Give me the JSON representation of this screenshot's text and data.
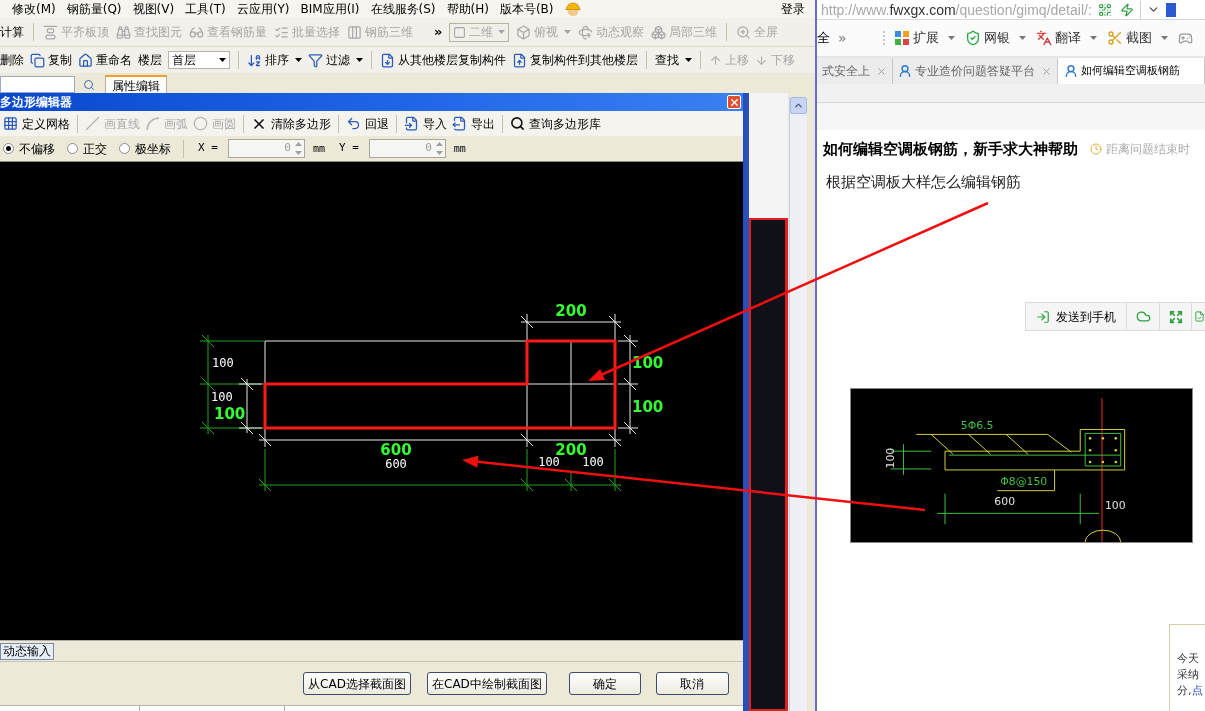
{
  "app": {
    "menu": [
      "修改(M)",
      "钢筋量(Q)",
      "视图(V)",
      "工具(T)",
      "云应用(Y)",
      "BIM应用(I)",
      "在线服务(S)",
      "帮助(H)",
      "版本号(B)"
    ],
    "login": "登录",
    "toolbar_1": [
      {
        "label": "计算",
        "disabled": false
      },
      {
        "label": "平齐板顶",
        "disabled": true
      },
      {
        "label": "查找图元",
        "disabled": true
      },
      {
        "label": "查看钢筋量",
        "disabled": true
      },
      {
        "label": "批量选择",
        "disabled": true
      },
      {
        "label": "钢筋三维",
        "disabled": true
      }
    ],
    "toolbar_1_overflow": "»",
    "view_select": {
      "value": "二维",
      "disabled": true
    },
    "toolbar_1_views": [
      {
        "label": "俯视",
        "disabled": true,
        "dropdown": true
      },
      {
        "label": "动态观察",
        "disabled": true,
        "dropdown": false
      },
      {
        "label": "局部三维",
        "disabled": true,
        "dropdown": false
      },
      {
        "label": "全屏",
        "disabled": true,
        "dropdown": false
      }
    ],
    "toolbar_2": [
      {
        "kind": "button",
        "label": "删除",
        "disabled": false
      },
      {
        "kind": "button",
        "label": "复制",
        "disabled": false
      },
      {
        "kind": "button",
        "label": "重命名",
        "disabled": false
      },
      {
        "kind": "label",
        "label": "楼层",
        "disabled": false
      },
      {
        "kind": "select",
        "label": "首层",
        "disabled": false
      },
      {
        "kind": "menu",
        "label": "排序",
        "disabled": false
      },
      {
        "kind": "menu",
        "label": "过滤",
        "disabled": false
      },
      {
        "kind": "button",
        "label": "从其他楼层复制构件",
        "disabled": false
      },
      {
        "kind": "button",
        "label": "复制构件到其他楼层",
        "disabled": false
      },
      {
        "kind": "menu",
        "label": "查找",
        "disabled": false
      },
      {
        "kind": "button",
        "label": "上移",
        "disabled": true
      },
      {
        "kind": "button",
        "label": "下移",
        "disabled": true
      }
    ],
    "panel_tab": "属性编辑"
  },
  "dialog": {
    "title": "多边形编辑器",
    "tools": [
      {
        "label": "定义网格",
        "disabled": false
      },
      {
        "label": "画直线",
        "disabled": true
      },
      {
        "label": "画弧",
        "disabled": true
      },
      {
        "label": "画圆",
        "disabled": true
      },
      {
        "label": "清除多边形",
        "disabled": false
      },
      {
        "label": "回退",
        "disabled": false
      },
      {
        "label": "导入",
        "disabled": false
      },
      {
        "label": "导出",
        "disabled": false
      },
      {
        "label": "查询多边形库",
        "disabled": false
      }
    ],
    "snap_modes": [
      {
        "label": "不偏移",
        "selected": true
      },
      {
        "label": "正交",
        "selected": false
      },
      {
        "label": "极坐标",
        "selected": false
      }
    ],
    "coords": [
      {
        "label": "X =",
        "value": "0",
        "unit": "mm"
      },
      {
        "label": "Y =",
        "value": "0",
        "unit": "mm"
      }
    ],
    "canvas_labels": [
      {
        "text": "200",
        "color": "#33ff33"
      },
      {
        "text": "100",
        "color": "#ffffff"
      },
      {
        "text": "100",
        "color": "#33ff33"
      },
      {
        "text": "100",
        "color": "#ffffff"
      },
      {
        "text": "100",
        "color": "#33ff33"
      },
      {
        "text": "100",
        "color": "#33ff33"
      },
      {
        "text": "600",
        "color": "#33ff33"
      },
      {
        "text": "200",
        "color": "#33ff33"
      },
      {
        "text": "600",
        "color": "#ffffff"
      },
      {
        "text": "100",
        "color": "#ffffff"
      },
      {
        "text": "100",
        "color": "#ffffff"
      }
    ],
    "dynamic_input": "动态输入",
    "buttons": [
      "从CAD选择截面图",
      "在CAD中绘制截面图",
      "确定",
      "取消"
    ]
  },
  "browser": {
    "url": {
      "scheme": "http://www.",
      "host": "fwxgx.com",
      "path": "/question/gimq/detail/:"
    },
    "toolbar_cut": "全",
    "toolbar_overflow": "»",
    "tools": [
      {
        "label": "扩展"
      },
      {
        "label": "网银"
      },
      {
        "label": "翻译"
      },
      {
        "label": "截图"
      }
    ],
    "tabs": [
      {
        "label": "式安全上",
        "selected": false
      },
      {
        "label": "专业造价问题答疑平台",
        "selected": false
      },
      {
        "label": "如何编辑空调板钢筋",
        "selected": true
      }
    ],
    "question": {
      "title": "如何编辑空调板钢筋，新手求大神帮助",
      "deadline": "距离问题结束时",
      "body": "根据空调板大样怎么编辑钢筋"
    },
    "share": {
      "send": "发送到手机"
    },
    "image_labels": [
      "5Φ6.5",
      "Φ8@150",
      "100",
      "600",
      "100"
    ],
    "popup": {
      "lines": [
        "今天",
        "采纳"
      ],
      "last": "分,",
      "link": "点"
    }
  }
}
